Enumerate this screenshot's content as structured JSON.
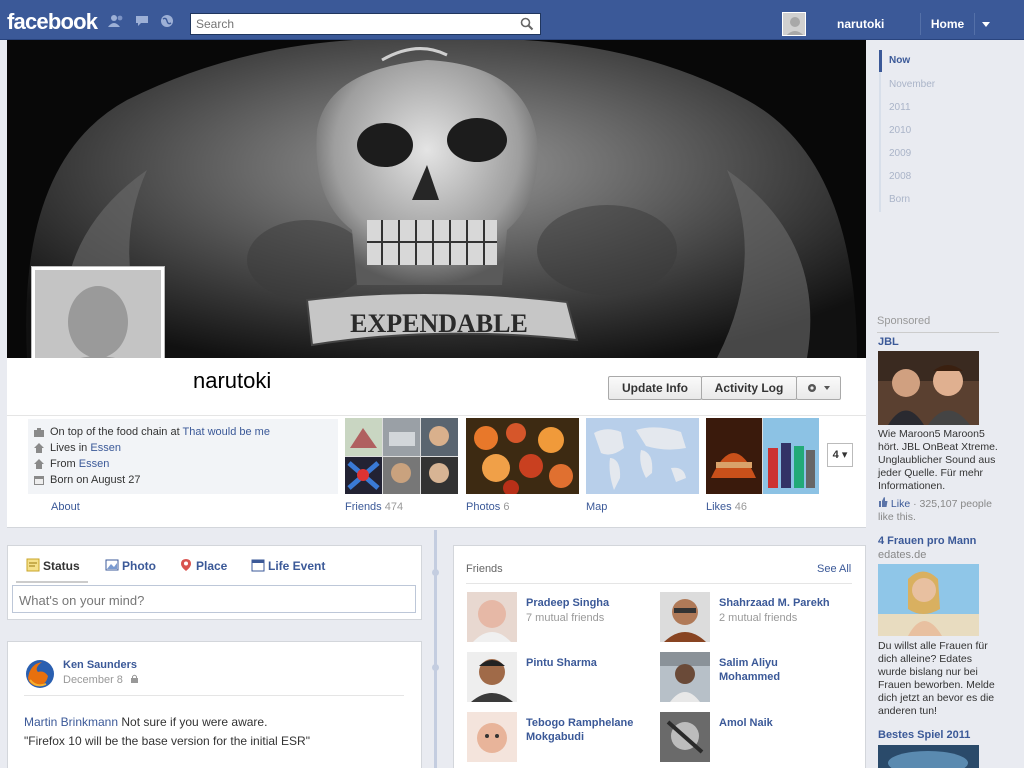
{
  "topbar": {
    "logo": "facebook",
    "search_placeholder": "Search",
    "user_name": "narutoki",
    "home_label": "Home"
  },
  "profile": {
    "name": "narutoki",
    "cover_text": "EXPENDABLE",
    "buttons": {
      "update_info": "Update Info",
      "activity_log": "Activity Log"
    },
    "about": {
      "work_prefix": "On top of the food chain at",
      "work_link": "That would be me",
      "lives_prefix": "Lives in",
      "lives_link": "Essen",
      "from_prefix": "From",
      "from_link": "Essen",
      "born": "Born on August 27",
      "about_label": "About"
    },
    "apps": [
      {
        "label": "Friends",
        "count": "474"
      },
      {
        "label": "Photos",
        "count": "6"
      },
      {
        "label": "Map",
        "count": ""
      },
      {
        "label": "Likes",
        "count": "46"
      }
    ],
    "apps_more": "4"
  },
  "composer": {
    "tabs": [
      "Status",
      "Photo",
      "Place",
      "Life Event"
    ],
    "placeholder": "What's on your mind?"
  },
  "post": {
    "author": "Ken Saunders",
    "date": "December 8",
    "mention": "Martin Brinkmann",
    "line1_text": " Not sure if you were aware.",
    "line2": "\"Firefox 10 will be the base version for the initial ESR\""
  },
  "friends": {
    "title": "Friends",
    "see_all": "See All",
    "list": [
      {
        "name": "Pradeep Singha",
        "mutual": "7 mutual friends"
      },
      {
        "name": "Shahrzaad M. Parekh",
        "mutual": "2 mutual friends"
      },
      {
        "name": "Pintu Sharma",
        "mutual": ""
      },
      {
        "name": "Salim Aliyu Mohammed",
        "mutual": ""
      },
      {
        "name": "Tebogo Ramphelane Mokgabudi",
        "mutual": ""
      },
      {
        "name": "Amol Naik",
        "mutual": ""
      }
    ]
  },
  "timeline_nav": [
    "Now",
    "November",
    "2011",
    "2010",
    "2009",
    "2008",
    "Born"
  ],
  "sponsored": {
    "label": "Sponsored",
    "ad1": {
      "title": "JBL",
      "text": "Wie Maroon5 Maroon5 hört. JBL OnBeat Xtreme. Unglaublicher Sound aus jeder Quelle. Für mehr Informationen.",
      "like_label": "Like",
      "like_text": "· 325,107 people like this."
    },
    "ad2": {
      "title": "4 Frauen pro Mann",
      "sub": "edates.de",
      "text": "Du willst alle Frauen für dich alleine? Edates wurde bislang nur bei Frauen beworben. Melde dich jetzt an bevor es die anderen tun!"
    },
    "ad3": {
      "title": "Bestes Spiel 2011"
    }
  },
  "colors": {
    "brand": "#3b5998",
    "background": "#e9ebf1"
  }
}
